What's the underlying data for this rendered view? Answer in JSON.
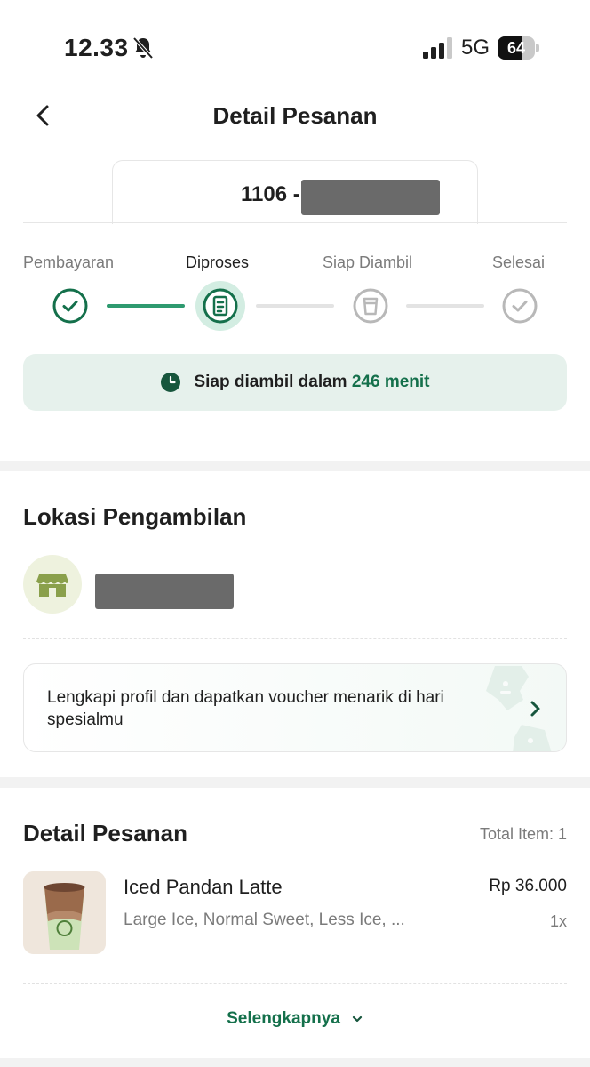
{
  "status_bar": {
    "time": "12.33",
    "network": "5G",
    "battery": "64",
    "battery_level": 0.64
  },
  "header": {
    "title": "Detail Pesanan"
  },
  "order": {
    "number_prefix": "1106 -"
  },
  "steps": [
    {
      "label": "Pembayaran",
      "state": "done",
      "icon": "check-icon"
    },
    {
      "label": "Diproses",
      "state": "active",
      "icon": "processing-icon"
    },
    {
      "label": "Siap Diambil",
      "state": "pending",
      "icon": "cup-icon"
    },
    {
      "label": "Selesai",
      "state": "pending",
      "icon": "check-icon"
    }
  ],
  "ready": {
    "text": "Siap diambil dalam",
    "highlight": "246 menit"
  },
  "pickup": {
    "title": "Lokasi Pengambilan"
  },
  "promo": {
    "text": "Lengkapi profil dan dapatkan voucher menarik di hari spesialmu"
  },
  "order_detail": {
    "title": "Detail Pesanan",
    "total_items": "Total Item: 1",
    "items": [
      {
        "name": "Iced Pandan Latte",
        "options": "Large Ice, Normal Sweet, Less Ice, ...",
        "price": "Rp 36.000",
        "qty": "1x"
      }
    ],
    "see_more": "Selengkapnya"
  },
  "colors": {
    "primary": "#14704b",
    "accent": "#2e9a6f",
    "ready_bg": "#e6f1ec"
  }
}
